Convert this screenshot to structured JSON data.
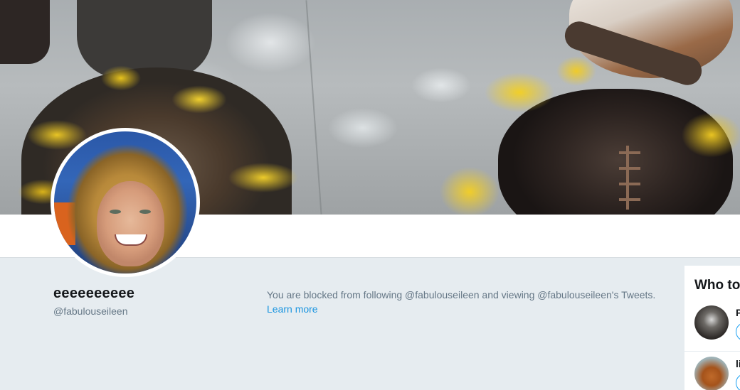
{
  "profile": {
    "display_name": "eeeeeeeeee",
    "handle": "@fabulouseileen"
  },
  "notice": {
    "text": "You are blocked from following @fabulouseileen and viewing @fabulouseileen's Tweets. ",
    "link_label": "Learn more"
  },
  "who_to_follow": {
    "title": "Who to follow",
    "items": [
      {
        "name": "P"
      },
      {
        "name": "li"
      }
    ]
  },
  "colors": {
    "page_bg": "#e6ecf0",
    "link": "#1b95e0",
    "muted": "#657786",
    "text": "#14171a"
  }
}
